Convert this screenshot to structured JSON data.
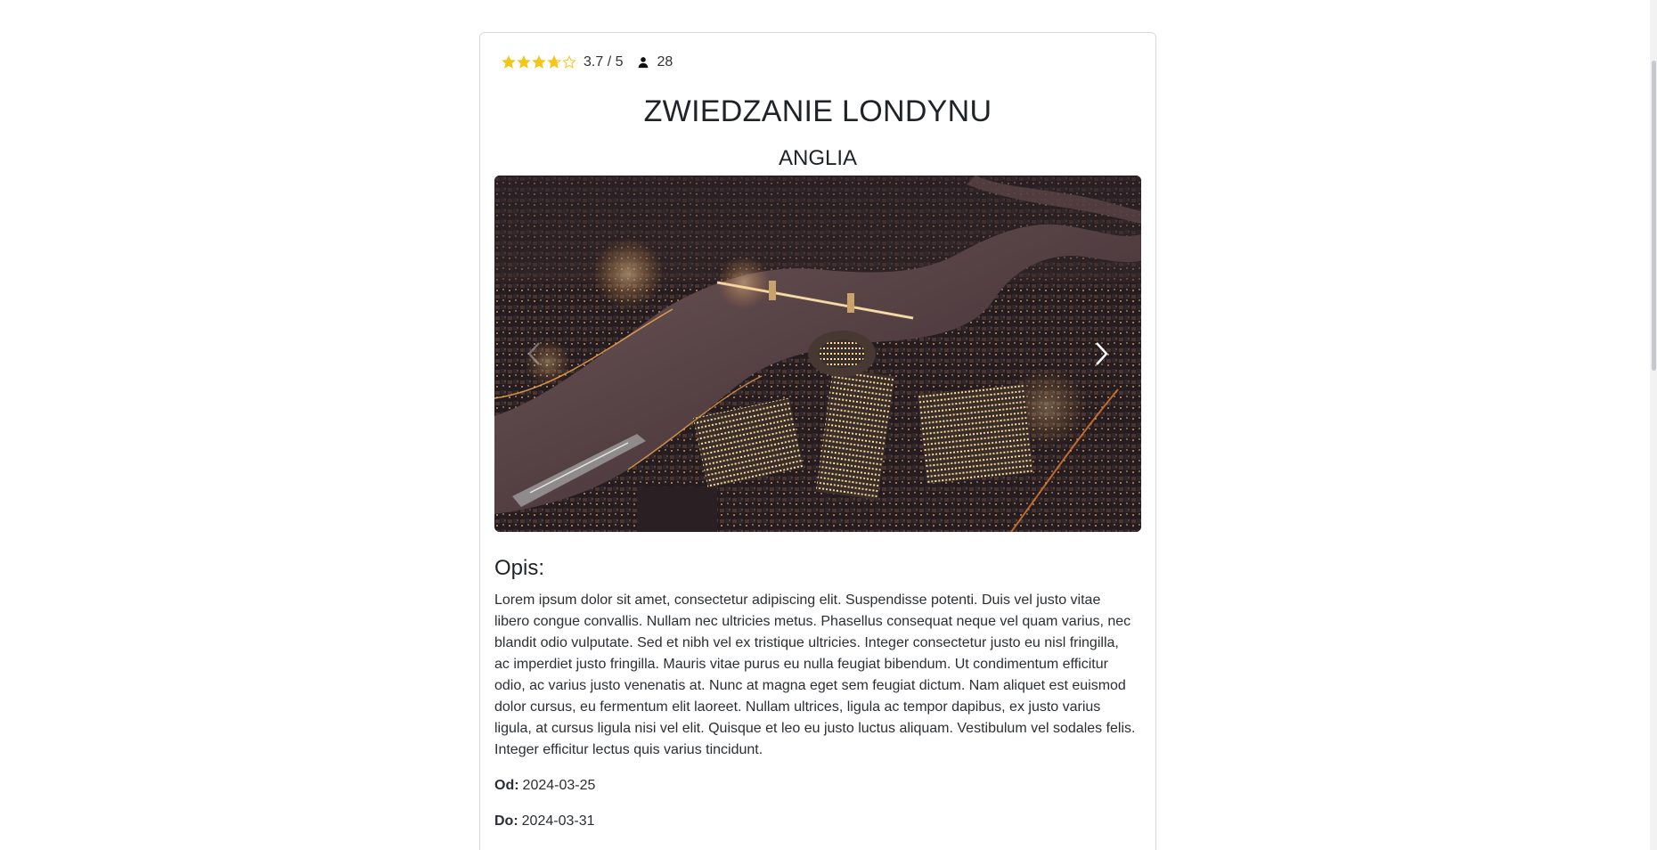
{
  "rating": {
    "value_text": "3.7 / 5",
    "value": 3.7,
    "max": 5,
    "reviews_count": "28",
    "star_color": "#f5c518"
  },
  "trip": {
    "title": "ZWIEDZANIE LONDYNU",
    "country": "ANGLIA"
  },
  "description": {
    "heading": "Opis:",
    "text": "Lorem ipsum dolor sit amet, consectetur adipiscing elit. Suspendisse potenti. Duis vel justo vitae libero congue convallis. Nullam nec ultricies metus. Phasellus consequat neque vel quam varius, nec blandit odio vulputate. Sed et nibh vel ex tristique ultricies. Integer consectetur justo eu nisl fringilla, ac imperdiet justo fringilla. Mauris vitae purus eu nulla feugiat bibendum. Ut condimentum efficitur odio, ac varius justo venenatis at. Nunc at magna eget sem feugiat dictum. Nam aliquet est euismod dolor cursus, eu fermentum elit laoreet. Nullam ultrices, ligula ac tempor dapibus, ex justo varius ligula, at cursus ligula nisi vel elit. Quisque et leo eu justo luctus aliquam. Vestibulum vel sodales felis. Integer efficitur lectus quis varius tincidunt."
  },
  "dates": {
    "from_label": "Od:",
    "from_value": "2024-03-25",
    "to_label": "Do:",
    "to_value": "2024-03-31"
  },
  "icons": {
    "person": "person-icon",
    "prev": "chevron-left-icon",
    "next": "chevron-right-icon"
  }
}
